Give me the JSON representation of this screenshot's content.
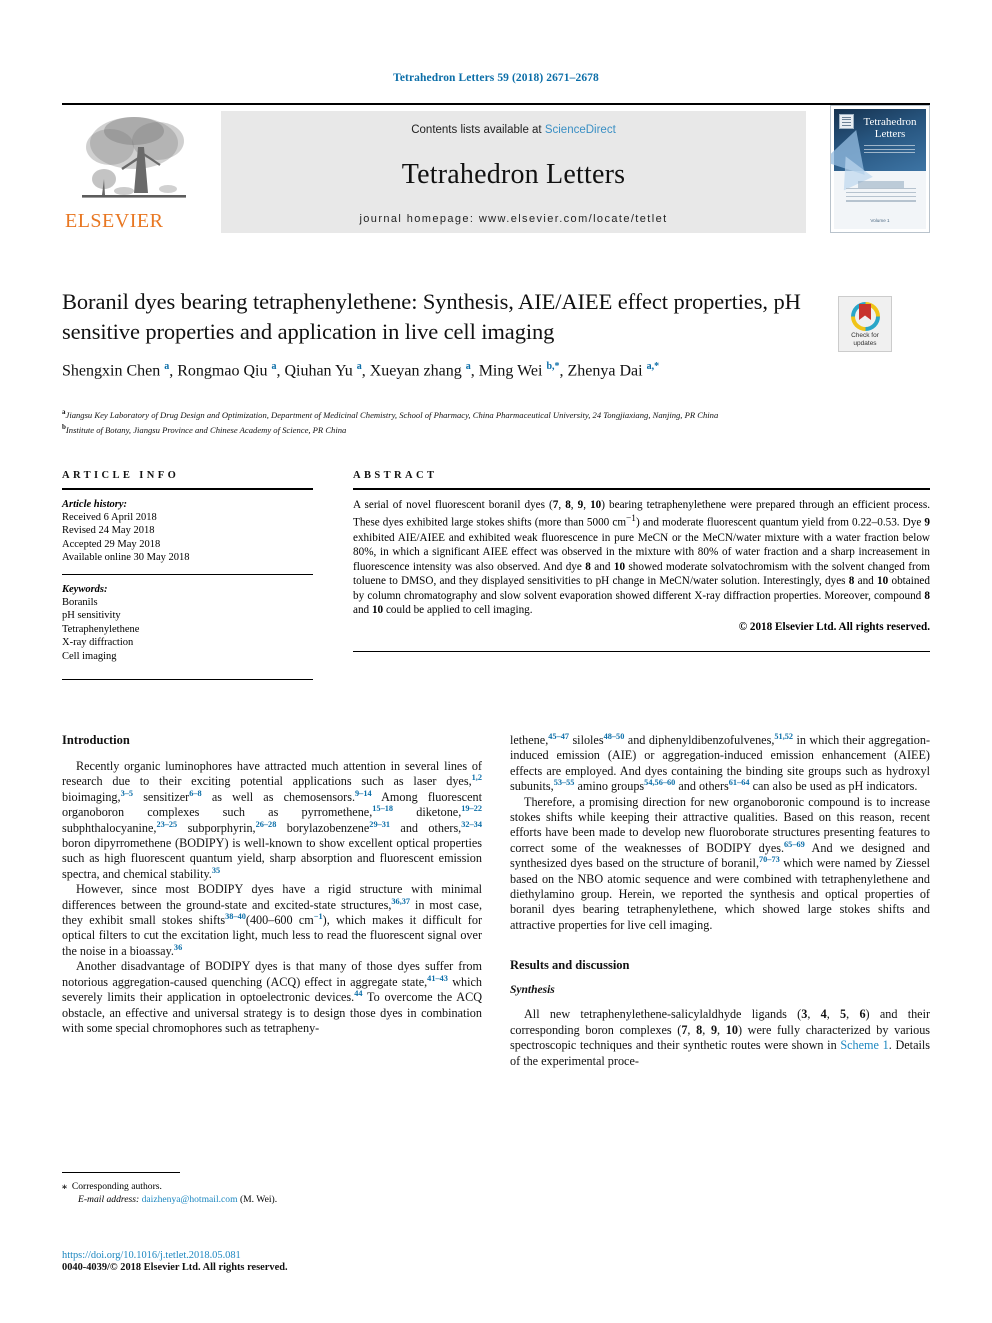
{
  "running_head": "Tetrahedron Letters 59 (2018) 2671–2678",
  "masthead": {
    "publisher": "ELSEVIER",
    "contents_prefix": "Contents lists available at ",
    "contents_link": "ScienceDirect",
    "journal_title": "Tetrahedron Letters",
    "homepage": "journal homepage: www.elsevier.com/locate/tetlet",
    "cover": {
      "title_line1": "Tetrahedron",
      "title_line2": "Letters",
      "footer": "Volume 1"
    }
  },
  "title": "Boranil dyes bearing tetraphenylethene: Synthesis, AIE/AIEE effect properties, pH sensitive properties and application in live cell imaging",
  "authors_html": "Shengxin Chen <sup>a</sup>, Rongmao Qiu <sup>a</sup>, Qiuhan Yu <sup>a</sup>, Xueyan zhang <sup>a</sup>, Ming Wei <sup>b,*</sup>, Zhenya Dai <sup>a,*</sup>",
  "affiliations": {
    "a": "Jiangsu Key Laboratory of Drug Design and Optimization, Department of Medicinal Chemistry, School of Pharmacy, China Pharmaceutical University, 24 Tongjiaxiang, Nanjing, PR China",
    "b": "Institute of Botany, Jiangsu Province and Chinese Academy of Science, PR China"
  },
  "crossmark": {
    "line1": "Check for",
    "line2": "updates"
  },
  "article_info": {
    "heading": "ARTICLE INFO",
    "history_label": "Article history:",
    "history": [
      "Received 6 April 2018",
      "Revised 24 May 2018",
      "Accepted 29 May 2018",
      "Available online 30 May 2018"
    ],
    "keywords_label": "Keywords:",
    "keywords": [
      "Boranils",
      "pH sensitivity",
      "Tetraphenylethene",
      "X-ray diffraction",
      "Cell imaging"
    ]
  },
  "abstract": {
    "heading": "ABSTRACT",
    "body_html": "A serial of novel fluorescent boranil dyes (<b>7</b>, <b>8</b>, <b>9</b>, <b>10</b>) bearing tetraphenylethene were prepared through an efficient process. These dyes exhibited large stokes shifts (more than 5000 cm<sup>−1</sup>) and moderate fluorescent quantum yield from 0.22–0.53. Dye <b>9</b> exhibited AIE/AIEE and exhibited weak fluorescence in pure MeCN or the MeCN/water mixture with a water fraction below 80%, in which a significant AIEE effect was observed in the mixture with 80% of water fraction and a sharp increasement in fluorescence intensity was also observed. And dye <b>8</b> and <b>10</b> showed moderate solvatochromism with the solvent changed from toluene to DMSO, and they displayed sensitivities to pH change in MeCN/water solution. Interestingly, dyes <b>8</b> and <b>10</b> obtained by column chromatography and slow solvent evaporation showed different X-ray diffraction properties. Moreover, compound <b>8</b> and <b>10</b> could be applied to cell imaging.",
    "copyright": "© 2018 Elsevier Ltd. All rights reserved."
  },
  "body": {
    "left": {
      "heading": "Introduction",
      "para1_html": "Recently organic luminophores have attracted much attention in several lines of research due to their exciting potential applications such as laser dyes,<sup>1,2</sup> bioimaging,<sup>3–5</sup> sensitizer<sup>6–8</sup> as well as chemosensors.<sup>9–14</sup> Among fluorescent organoboron complexes such as pyrromethene,<sup>15–18</sup> diketone,<sup>19–22</sup> subphthalocyanine,<sup>23–25</sup> subporphyrin,<sup>26–28</sup> borylazobenzene<sup>29–31</sup> and others,<sup>32–34</sup> boron dipyrromethene (BODIPY) is well-known to show excellent optical properties such as high fluorescent quantum yield, sharp absorption and fluorescent emission spectra, and chemical stability.<sup>35</sup>",
      "para2_html": "However, since most BODIPY dyes have a rigid structure with minimal differences between the ground-state and excited-state structures,<sup>36,37</sup> in most case, they exhibit small stokes shifts<sup>38–40</sup>(400–600 cm<sup>−1</sup>), which makes it difficult for optical filters to cut the excitation light, much less to read the fluorescent signal over the noise in a bioassay.<sup>36</sup>",
      "para3_html": "Another disadvantage of BODIPY dyes is that many of those dyes suffer from notorious aggregation-caused quenching (ACQ) effect in aggregate state,<sup>41–43</sup> which severely limits their application in optoelectronic devices.<sup>44</sup> To overcome the ACQ obstacle, an effective and universal strategy is to design those dyes in combination with some special chromophores such as tetrapheny-"
    },
    "right": {
      "para1_html": "lethene,<sup>45–47</sup> siloles<sup>48–50</sup> and diphenyldibenzofulvenes,<sup>51,52</sup> in which their aggregation-induced emission (AIE) or aggregation-induced emission enhancement (AIEE) effects are employed. And dyes containing the binding site groups such as hydroxyl subunits,<sup>53–55</sup> amino groups<sup>54,56–60</sup> and others<sup>61–64</sup> can also be used as pH indicators.",
      "para2_html": "Therefore, a promising direction for new organoboronic compound is to increase stokes shifts while keeping their attractive qualities. Based on this reason, recent efforts have been made to develop new fluoroborate structures presenting features to correct some of the weaknesses of BODIPY dyes.<sup>65–69</sup> And we designed and synthesized dyes based on the structure of boranil,<sup>70–73</sup> which were named by Ziessel based on the NBO atomic sequence and were combined with tetraphenylethene and diethylamino group. Herein, we reported the synthesis and optical properties of boranil dyes bearing tetraphenylethene, which showed large stokes shifts and attractive properties for live cell imaging.",
      "heading2": "Results and discussion",
      "heading3": "Synthesis",
      "para3_html": "All new tetraphenylethene-salicylaldhyde ligands (<b>3</b>, <b>4</b>, <b>5</b>, <b>6</b>) and their corresponding boron complexes (<b>7</b>, <b>8</b>, <b>9</b>, <b>10</b>) were fully characterized by various spectroscopic techniques and their synthetic routes were shown in <span class=\"lnk\">Scheme 1</span>. Details of the experimental proce-"
    }
  },
  "footnote": {
    "corresponding_html": "<span class=\"star\">⁎</span>&nbsp; Corresponding authors.",
    "email_html": "<span class=\"em\">E-mail address:</span> <a>daizhenya@hotmail.com</a> (M. Wei)."
  },
  "doi": "https://doi.org/10.1016/j.tetlet.2018.05.081",
  "issn_line": "0040-4039/© 2018 Elsevier Ltd. All rights reserved.",
  "colors": {
    "link_blue": "#1c87c0",
    "head_blue": "#0b6ea8",
    "elsevier_orange": "#E87722",
    "banner_bg": "#e8e8e8"
  }
}
